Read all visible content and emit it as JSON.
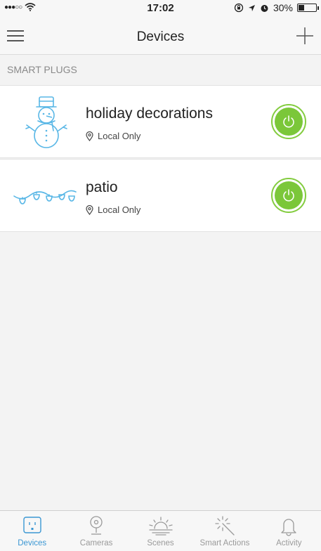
{
  "status_bar": {
    "carrier_signal": "●●●○○",
    "time": "17:02",
    "battery_percent": "30%",
    "battery_level": 0.3
  },
  "nav": {
    "title": "Devices"
  },
  "section": {
    "title": "SMART PLUGS"
  },
  "devices": [
    {
      "name": "holiday decorations",
      "location": "Local Only",
      "icon": "snowman-icon",
      "power_on": true
    },
    {
      "name": "patio",
      "location": "Local Only",
      "icon": "string-lights-icon",
      "power_on": true
    }
  ],
  "tabs": [
    {
      "label": "Devices",
      "icon": "plug-icon",
      "active": true
    },
    {
      "label": "Cameras",
      "icon": "camera-icon",
      "active": false
    },
    {
      "label": "Scenes",
      "icon": "sunrise-icon",
      "active": false
    },
    {
      "label": "Smart Actions",
      "icon": "magic-wand-icon",
      "active": false
    },
    {
      "label": "Activity",
      "icon": "bell-icon",
      "active": false
    }
  ],
  "colors": {
    "accent": "#3b97d3",
    "power_on": "#7bc739",
    "icon_blue": "#59b7e6"
  }
}
